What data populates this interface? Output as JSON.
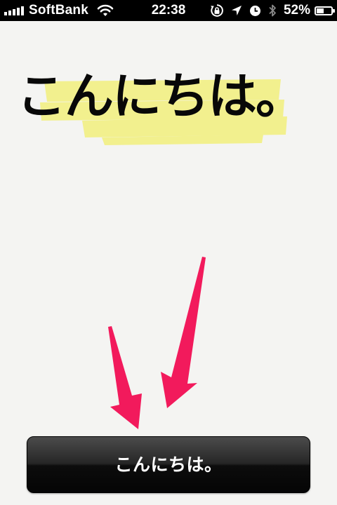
{
  "status_bar": {
    "carrier": "SoftBank",
    "time": "22:38",
    "battery_percent": "52%",
    "battery_level": 0.52,
    "signal_bars": 5,
    "icons": [
      "signal-icon",
      "wifi-icon",
      "rotation-lock-icon",
      "location-icon",
      "alarm-icon",
      "bluetooth-icon",
      "battery-icon"
    ]
  },
  "main": {
    "heading": "こんにちは。",
    "highlight_color": "#f2f08e",
    "arrow_color": "#f21a5c",
    "button_label": "こんにちは。"
  }
}
